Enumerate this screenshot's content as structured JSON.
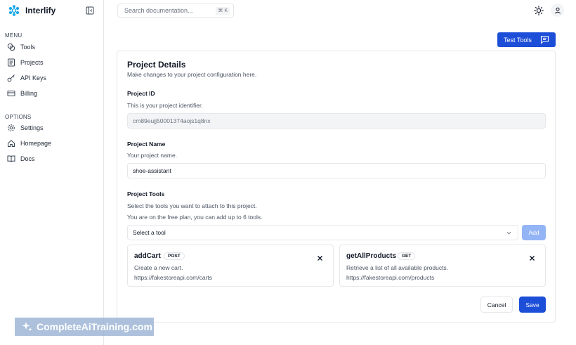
{
  "app": {
    "name": "Interlify",
    "brand_color": "#0ea5e9",
    "accent": "#1d4ed8"
  },
  "sidebar": {
    "menu_label": "MENU",
    "menu_items": [
      {
        "label": "Tools",
        "icon": "tools-icon"
      },
      {
        "label": "Projects",
        "icon": "projects-icon"
      },
      {
        "label": "API Keys",
        "icon": "key-icon"
      },
      {
        "label": "Billing",
        "icon": "card-icon"
      }
    ],
    "options_label": "OPTIONS",
    "option_items": [
      {
        "label": "Settings",
        "icon": "gear-icon"
      },
      {
        "label": "Homepage",
        "icon": "home-icon"
      },
      {
        "label": "Docs",
        "icon": "book-icon"
      }
    ]
  },
  "topbar": {
    "search_placeholder": "Search documentation...",
    "shortcut": "⌘ K"
  },
  "test_tools_label": "Test Tools",
  "project": {
    "title": "Project Details",
    "subtitle": "Make changes to your project configuration here.",
    "id_label": "Project ID",
    "id_help": "This is your project identifier.",
    "id_value": "cm89eujj50001374aojs1q8nx",
    "name_label": "Project Name",
    "name_help": "Your project name.",
    "name_value": "shoe-assistant",
    "tools_label": "Project Tools",
    "tools_help": "Select the tools you want to attach to this project.",
    "plan_note": "You are on the free plan, you can add up to 6 tools.",
    "select_value": "Select a tool",
    "add_label": "Add",
    "tools": [
      {
        "name": "addCart",
        "method": "POST",
        "desc": "Create a new cart.",
        "url": "https://fakestoreapi.com/carts"
      },
      {
        "name": "getAllProducts",
        "method": "GET",
        "desc": "Retrieve a list of all available products.",
        "url": "https://fakestoreapi.com/products"
      }
    ],
    "cancel_label": "Cancel",
    "save_label": "Save"
  },
  "watermark": "CompleteAiTraining.com"
}
